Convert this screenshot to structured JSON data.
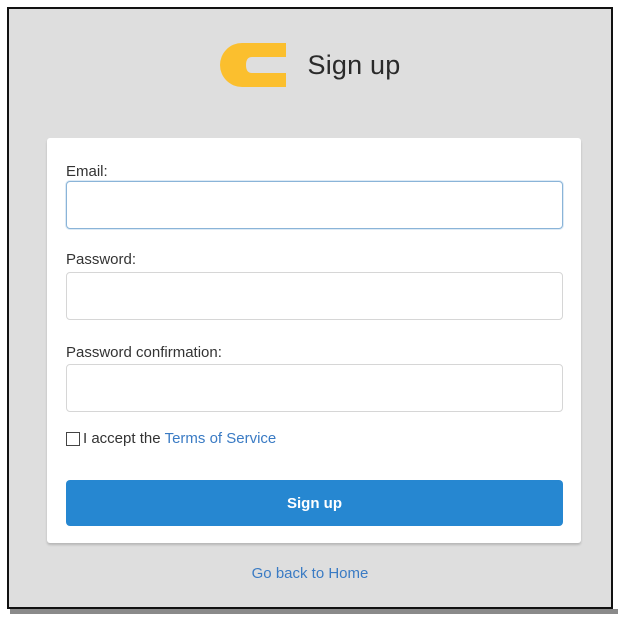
{
  "header": {
    "title": "Sign up",
    "logo_icon": "c-logo-icon",
    "logo_color": "#fbbf2e"
  },
  "form": {
    "email_label": "Email:",
    "email_value": "",
    "password_label": "Password:",
    "password_value": "",
    "confirm_label": "Password confirmation:",
    "confirm_value": "",
    "terms_prefix": "I accept the",
    "terms_link": "Terms of Service",
    "terms_checked": false,
    "submit_label": "Sign up"
  },
  "footer": {
    "home_link": "Go back to Home"
  },
  "colors": {
    "accent": "#2687d1",
    "link": "#3a7bc4",
    "background": "#dedede"
  }
}
